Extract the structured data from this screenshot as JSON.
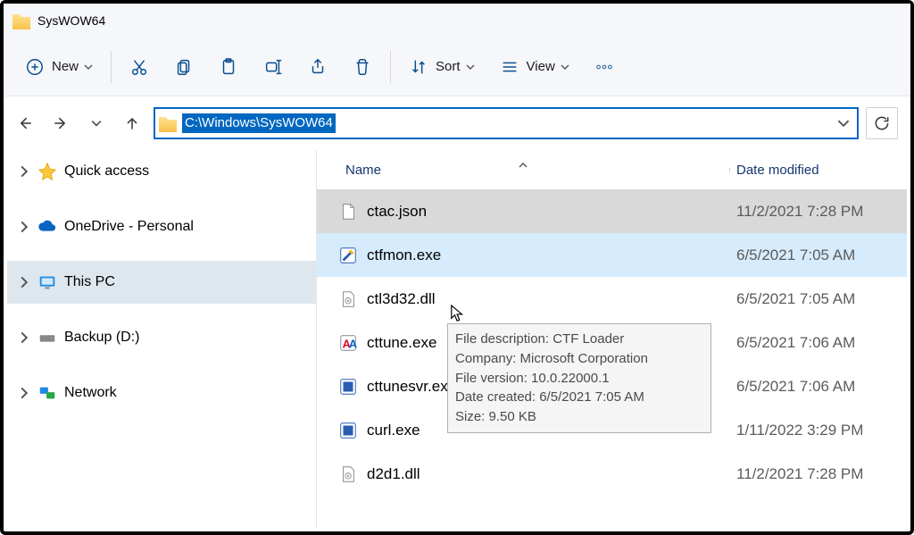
{
  "window": {
    "title": "SysWOW64"
  },
  "toolbar": {
    "new": "New",
    "sort": "Sort",
    "view": "View"
  },
  "address": {
    "path": "C:\\Windows\\SysWOW64"
  },
  "sidebar": {
    "items": [
      {
        "label": "Quick access",
        "icon": "star"
      },
      {
        "label": "OneDrive - Personal",
        "icon": "onedrive"
      },
      {
        "label": "This PC",
        "icon": "pc",
        "selected": true
      },
      {
        "label": "Backup (D:)",
        "icon": "hdd"
      },
      {
        "label": "Network",
        "icon": "network"
      }
    ]
  },
  "columns": {
    "name": "Name",
    "date": "Date modified"
  },
  "files": [
    {
      "name": "ctac.json",
      "date": "11/2/2021 7:28 PM",
      "icon": "file",
      "selected": true
    },
    {
      "name": "ctfmon.exe",
      "date": "6/5/2021 7:05 AM",
      "icon": "ctfmon",
      "hover": true
    },
    {
      "name": "ctl3d32.dll",
      "date": "6/5/2021 7:05 AM",
      "icon": "dll"
    },
    {
      "name": "cttune.exe",
      "date": "6/5/2021 7:06 AM",
      "icon": "cttune"
    },
    {
      "name": "cttunesvr.exe",
      "date": "6/5/2021 7:06 AM",
      "icon": "cttunesvr"
    },
    {
      "name": "curl.exe",
      "date": "1/11/2022 3:29 PM",
      "icon": "curl"
    },
    {
      "name": "d2d1.dll",
      "date": "11/2/2021 7:28 PM",
      "icon": "dll"
    }
  ],
  "tooltip": {
    "l1": "File description: CTF Loader",
    "l2": "Company: Microsoft Corporation",
    "l3": "File version: 10.0.22000.1",
    "l4": "Date created: 6/5/2021 7:05 AM",
    "l5": "Size: 9.50 KB"
  }
}
